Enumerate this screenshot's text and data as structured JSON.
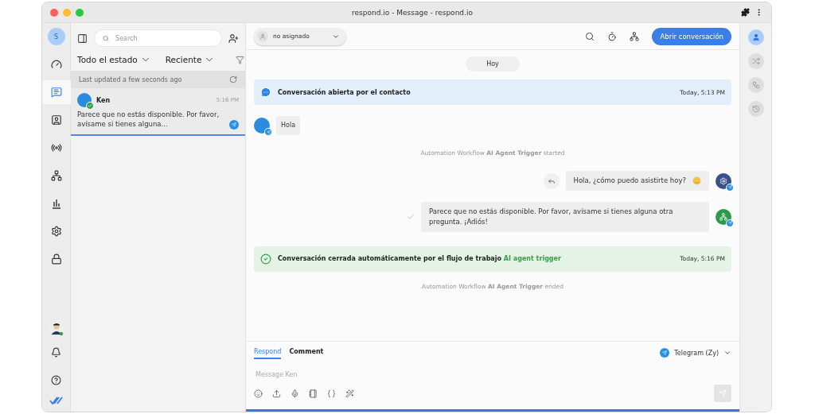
{
  "window": {
    "title": "respond.io - Message - respond.io"
  },
  "left_nav": {
    "avatar": "S",
    "items": [
      {
        "kind": "dashboard",
        "selected": false
      },
      {
        "kind": "messages",
        "selected": true
      },
      {
        "kind": "contacts",
        "selected": false
      },
      {
        "kind": "broadcasts",
        "selected": false
      },
      {
        "kind": "workflows",
        "selected": false
      },
      {
        "kind": "reports",
        "selected": false
      },
      {
        "kind": "settings",
        "selected": false
      },
      {
        "kind": "security",
        "selected": false
      }
    ]
  },
  "list_panel": {
    "search": {
      "placeholder": "Search"
    },
    "filters": [
      "Todo el estado",
      "Reciente"
    ],
    "status": "Last updated a few seconds ago",
    "conversations": [
      {
        "name": "Ken",
        "time": "5:16 PM",
        "preview": "Parece que no estás disponible. Por favor, avísame si tienes alguna...",
        "selected": true
      }
    ]
  },
  "header": {
    "assignee": "no asignado",
    "button": "Abrir conversación"
  },
  "messages": [
    {
      "kind": "date",
      "text": "Hoy"
    },
    {
      "kind": "opened",
      "text": "Conversación abierta por el contacto",
      "time": "Today, 5:13 PM"
    },
    {
      "kind": "incoming",
      "text": "Hola"
    },
    {
      "kind": "log",
      "text": "Automation Workflow **AI Agent Trigger** started"
    },
    {
      "kind": "outgoing",
      "text": "Hola, ¿cómo puedo asistirte hoy?",
      "avatar": {
        "kind": "bot"
      },
      "emoji": true,
      "reply": true
    },
    {
      "kind": "outgoing",
      "text": "Parece que no estás disponible. Por favor, avísame si tienes alguna otra pregunta. ¡Adiós!",
      "avatar": {
        "kind": "workflow"
      },
      "emoji": false,
      "reply": false
    },
    {
      "kind": "closed",
      "text": "Conversación cerrada automáticamente por el flujo de trabajo",
      "link": "AI agent trigger",
      "time": "Today, 5:16 PM"
    },
    {
      "kind": "log",
      "text": "Automation Workflow **AI Agent Trigger** ended"
    }
  ],
  "composer": {
    "tabs": [
      {
        "label": "Respond",
        "selected": true
      },
      {
        "label": "Comment",
        "selected": false
      }
    ],
    "channel": "Telegram (Zy)",
    "placeholder": "Message Ken"
  },
  "right_rail": {
    "items": [
      {
        "kind": "profile",
        "selected": true
      },
      {
        "kind": "merge",
        "selected": false
      },
      {
        "kind": "workflow",
        "selected": false
      },
      {
        "kind": "history",
        "selected": false
      }
    ]
  }
}
